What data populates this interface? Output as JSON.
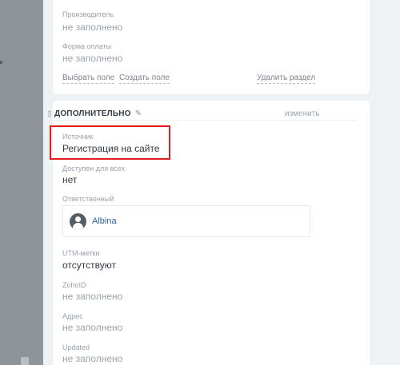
{
  "top_section": {
    "fields": [
      {
        "label": "Производитель",
        "value": "не заполнено"
      },
      {
        "label": "Форма оплаты",
        "value": "не заполнено"
      }
    ],
    "actions": {
      "select_field": "Выбрать поле",
      "create_field": "Создать поле",
      "delete_section": "Удалить раздел"
    }
  },
  "additional_section": {
    "title": "ДОПОЛНИТЕЛЬНО",
    "edit_label": "изменить",
    "source": {
      "label": "Источник",
      "value": "Регистрация на сайте"
    },
    "public": {
      "label": "Доступен для всех",
      "value": "нет"
    },
    "responsible": {
      "label": "Ответственный",
      "name": "Albina"
    },
    "utm": {
      "label": "UTM-метки",
      "value": "отсутствуют"
    },
    "zoho": {
      "label": "ZohoID",
      "value": "не заполнено"
    },
    "address": {
      "label": "Адрес",
      "value": "не заполнено"
    },
    "updated": {
      "label": "Updated",
      "value": "не заполнено"
    }
  },
  "colors": {
    "highlight": "#e01e1e",
    "link": "#2c5f9e",
    "sidebar": "#8e9499"
  },
  "icons": [
    "drag-handle-icon",
    "pencil-icon",
    "user-avatar-icon"
  ]
}
